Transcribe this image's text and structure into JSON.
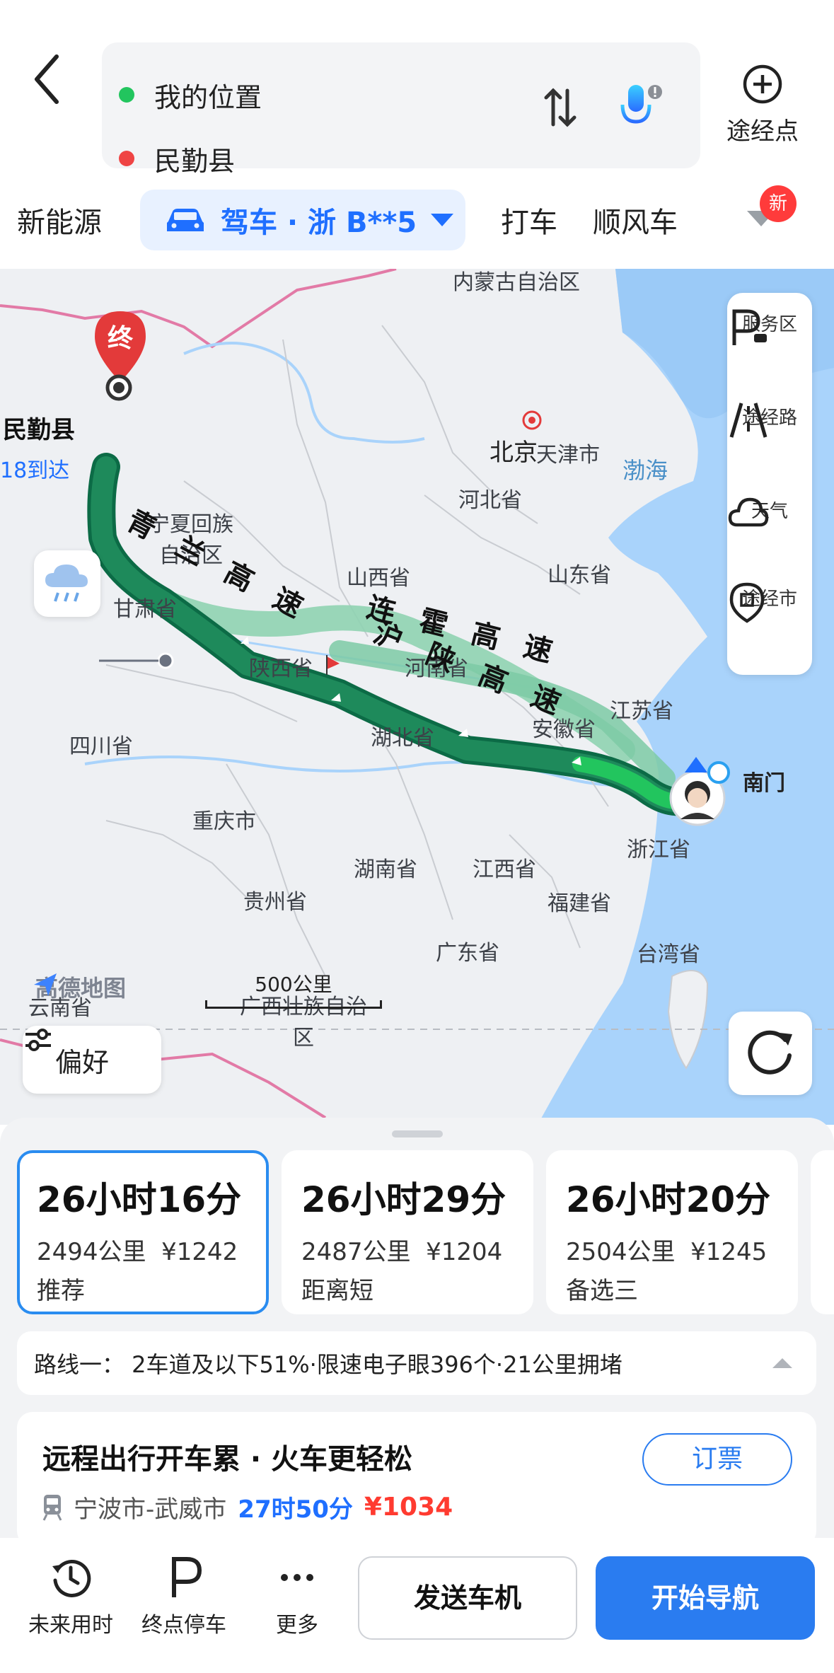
{
  "header": {
    "origin": "我的位置",
    "destination": "民勤县",
    "waypoint_label": "途经点",
    "colors": {
      "origin_dot": "#22c55e",
      "destination_dot": "#ef4444",
      "accent": "#1f6fff"
    }
  },
  "modes": {
    "new_energy": "新能源",
    "drive": "驾车 · 浙 B**5",
    "taxi": "打车",
    "carpool": "顺风车",
    "new_badge": "新"
  },
  "map": {
    "destination_name": "民勤县",
    "destination_marker": "终",
    "eta": "18到达",
    "place_labels": [
      "内蒙古自治区",
      "北京",
      "天津市",
      "河北省",
      "渤海",
      "宁夏回族自治区",
      "甘肃省",
      "山西省",
      "山东省",
      "陕西省",
      "河南省",
      "江苏省",
      "四川省",
      "湖北省",
      "安徽省",
      "重庆市",
      "浙江省",
      "湖南省",
      "江西省",
      "贵州省",
      "福建省",
      "广西壮族自治区",
      "广东省",
      "台湾省",
      "云南省"
    ],
    "highways": [
      "青兰高速",
      "连霍高速",
      "沪陕高速"
    ],
    "start_poi": "南门",
    "logo": "高德地图",
    "scale": "500公里",
    "side_panel": [
      "服务区",
      "途经路",
      "天气",
      "途经市"
    ],
    "preference": "偏好"
  },
  "routes": [
    {
      "time": "26小时16分",
      "distance": "2494公里",
      "cost": "¥1242",
      "tag": "推荐",
      "selected": true
    },
    {
      "time": "26小时29分",
      "distance": "2487公里",
      "cost": "¥1204",
      "tag": "距离短",
      "selected": false
    },
    {
      "time": "26小时20分",
      "distance": "2504公里",
      "cost": "¥1245",
      "tag": "备选三",
      "selected": false
    }
  ],
  "route_info": "路线一： 2车道及以下51%·限速电子眼396个·21公里拥堵",
  "train": {
    "title": "远程出行开车累 · 火车更轻松",
    "route": "宁波市-武威市",
    "duration": "27时50分",
    "price": "¥1034",
    "button": "订票"
  },
  "bottom_bar": {
    "future": "未来用时",
    "parking": "终点停车",
    "more": "更多",
    "send": "发送车机",
    "navigate": "开始导航"
  }
}
